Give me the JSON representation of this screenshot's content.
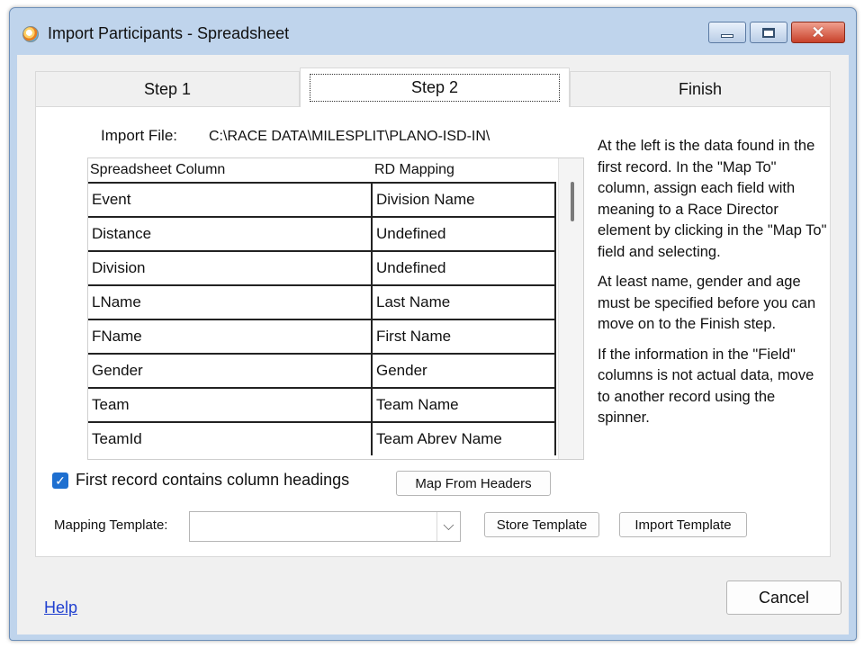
{
  "window": {
    "title": "Import Participants - Spreadsheet",
    "close_glyph": "✕",
    "app_icon": "race-director-icon"
  },
  "tabs": [
    {
      "label": "Step 1",
      "selected": false
    },
    {
      "label": "Step 2",
      "selected": true
    },
    {
      "label": "Finish",
      "selected": false
    }
  ],
  "import_file": {
    "label": "Import File:",
    "path": "C:\\RACE DATA\\MILESPLIT\\PLANO-ISD-IN\\"
  },
  "grid": {
    "columns": [
      "Spreadsheet Column",
      "RD Mapping"
    ],
    "rows": [
      {
        "column": "Event",
        "mapping": "Division Name"
      },
      {
        "column": "Distance",
        "mapping": "Undefined"
      },
      {
        "column": "Division",
        "mapping": "Undefined"
      },
      {
        "column": "LName",
        "mapping": "Last Name"
      },
      {
        "column": "FName",
        "mapping": "First Name"
      },
      {
        "column": "Gender",
        "mapping": "Gender"
      },
      {
        "column": "Team",
        "mapping": "Team Name"
      },
      {
        "column": "TeamId",
        "mapping": "Team Abrev Name"
      }
    ]
  },
  "first_record": {
    "label": "First record contains column headings",
    "checked": true,
    "check_glyph": "✓"
  },
  "buttons": {
    "map_from_headers": "Map From Headers",
    "store_template": "Store Template",
    "import_template": "Import Template",
    "cancel": "Cancel"
  },
  "mapping_template": {
    "label": "Mapping Template:",
    "value": "",
    "arrow_glyph": "⌵"
  },
  "help_text": [
    "At the left is the data found in the first record.  In the \"Map To\" column, assign each field with meaning to a Race Director element by clicking in the \"Map To\" field and selecting.",
    "At least name, gender and age must be specified before you can move on to the Finish step.",
    "If the information in the \"Field\" columns is not actual data, move to another record using the spinner."
  ],
  "help_link": "Help",
  "colors": {
    "checkbox": "#1e6fd0",
    "link": "#1f3fd0",
    "close_button": "#c8412a"
  }
}
